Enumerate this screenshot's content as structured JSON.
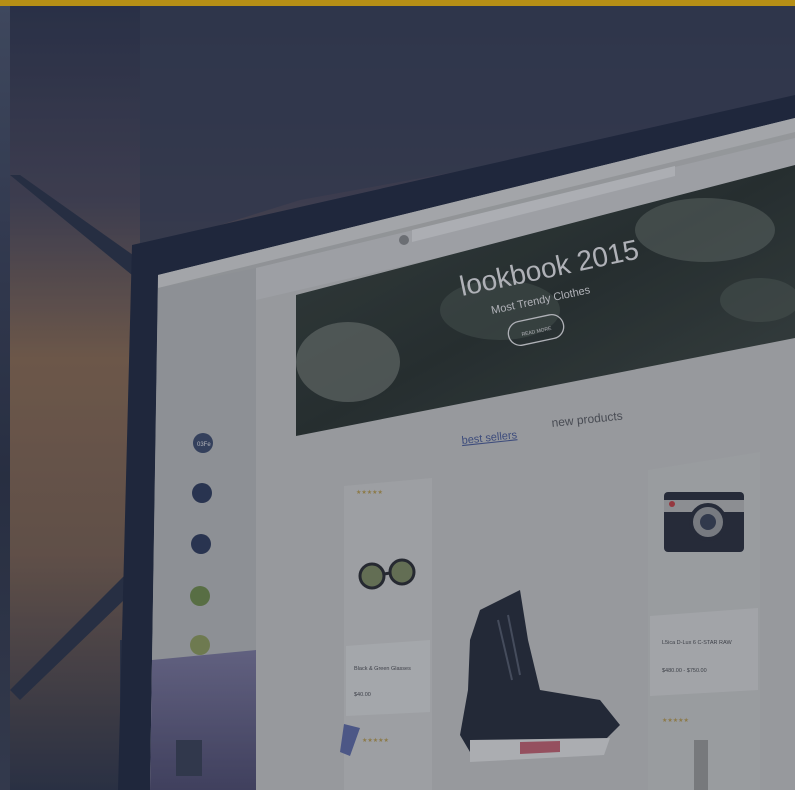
{
  "screen": {
    "hero": {
      "title": "lookbook 2015",
      "subtitle": "Most Trendy Clothes",
      "button_label": "READ MORE"
    },
    "tabs": {
      "best_sellers": "best sellers",
      "new_products": "new products"
    },
    "products": {
      "glasses_name": "Black & Green Glasses",
      "glasses_price": "$40.00",
      "camera_name": "L5ica D-Lux 6 C-STAR RAW",
      "camera_price": "$480.00 - $750.00"
    },
    "dock": {
      "app_icon_label": "03Fe"
    }
  },
  "colors": {
    "accent_bar": "#f2b705",
    "bezel": "#242b3b",
    "screen_bg": "#c9c8c2",
    "hero_dark": "#2b3228"
  }
}
